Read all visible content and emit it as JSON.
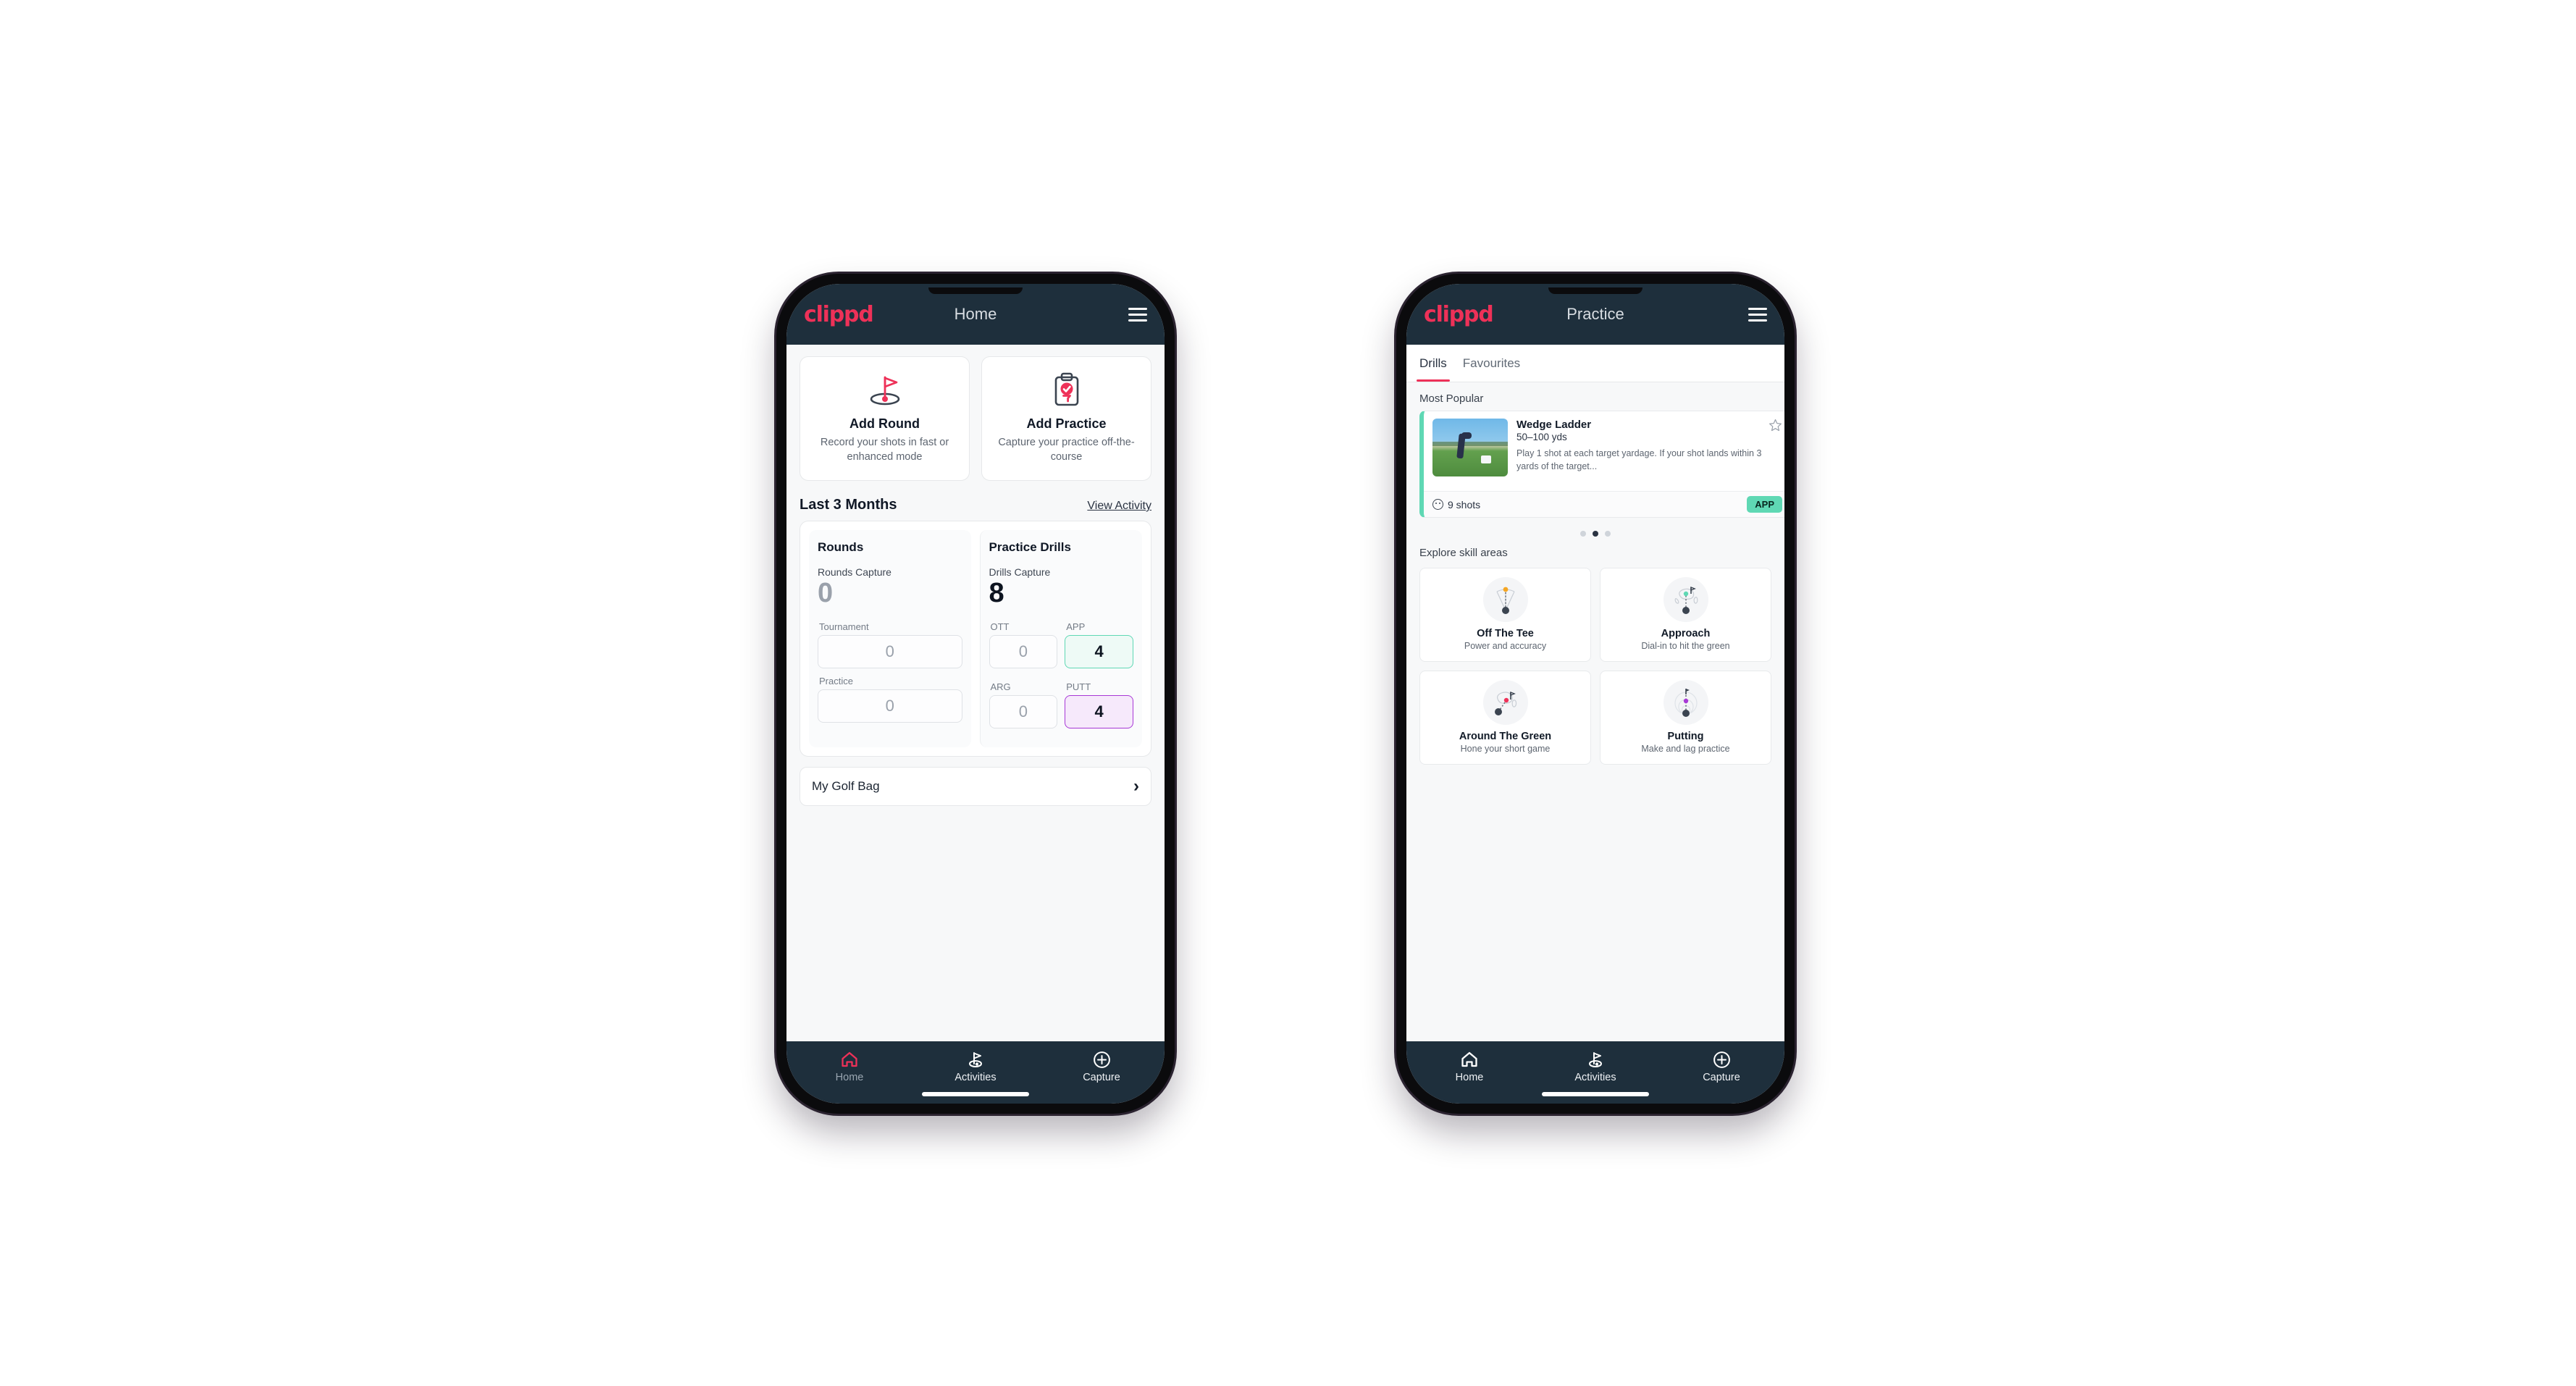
{
  "brand": {
    "logo_text": "clippd",
    "accent": "#ee3158",
    "appbar_bg": "#1e2f3c"
  },
  "phone_home": {
    "appbar": {
      "title": "Home",
      "menu_icon": "hamburger-menu-icon"
    },
    "actions": [
      {
        "icon": "golf-flag-hole-icon",
        "title": "Add Round",
        "subtitle": "Record your shots in fast or enhanced mode"
      },
      {
        "icon": "clipboard-check-icon",
        "title": "Add Practice",
        "subtitle": "Capture your practice off-the-course"
      }
    ],
    "section": {
      "title": "Last 3 Months",
      "link": "View Activity"
    },
    "rounds": {
      "heading": "Rounds",
      "capture_label": "Rounds Capture",
      "capture_value": "0",
      "fields": [
        {
          "label": "Tournament",
          "value": "0"
        },
        {
          "label": "Practice",
          "value": "0"
        }
      ]
    },
    "drills": {
      "heading": "Practice Drills",
      "capture_label": "Drills Capture",
      "capture_value": "8",
      "fields": [
        {
          "label": "OTT",
          "value": "0",
          "state": "plain"
        },
        {
          "label": "APP",
          "value": "4",
          "state": "app"
        },
        {
          "label": "ARG",
          "value": "0",
          "state": "plain"
        },
        {
          "label": "PUTT",
          "value": "4",
          "state": "putt"
        }
      ]
    },
    "bag_row": {
      "label": "My Golf Bag",
      "chevron": "›"
    },
    "bottom_nav": [
      {
        "icon": "home-icon",
        "label": "Home",
        "active": true
      },
      {
        "icon": "golf-flag-icon",
        "label": "Activities",
        "active": false
      },
      {
        "icon": "plus-circle-icon",
        "label": "Capture",
        "active": false
      }
    ]
  },
  "phone_practice": {
    "appbar": {
      "title": "Practice",
      "menu_icon": "hamburger-menu-icon"
    },
    "tabs": [
      {
        "label": "Drills",
        "active": true
      },
      {
        "label": "Favourites",
        "active": false
      }
    ],
    "most_popular_label": "Most Popular",
    "drill_card": {
      "title": "Wedge Ladder",
      "distance": "50–100 yds",
      "description": "Play 1 shot at each target yardage. If your shot lands within 3 yards of the target...",
      "shots": "9 shots",
      "badge": "APP",
      "badge_color": "#5fd8b4",
      "accent": "#5fd8b4",
      "star_icon": "star-outline-icon"
    },
    "carousel_dots": {
      "count": 3,
      "active_index": 1
    },
    "explore_label": "Explore skill areas",
    "skills": [
      {
        "icon": "off-the-tee-icon",
        "title": "Off The Tee",
        "subtitle": "Power and accuracy",
        "dot": "#f5a623"
      },
      {
        "icon": "approach-icon",
        "title": "Approach",
        "subtitle": "Dial-in to hit the green",
        "dot": "#5fd8b4"
      },
      {
        "icon": "around-the-green-icon",
        "title": "Around The Green",
        "subtitle": "Hone your short game",
        "dot": "#ee3158"
      },
      {
        "icon": "putting-icon",
        "title": "Putting",
        "subtitle": "Make and lag practice",
        "dot": "#a838d6"
      }
    ],
    "bottom_nav": [
      {
        "icon": "home-icon",
        "label": "Home",
        "active": false
      },
      {
        "icon": "golf-flag-icon",
        "label": "Activities",
        "active": true
      },
      {
        "icon": "plus-circle-icon",
        "label": "Capture",
        "active": false
      }
    ]
  }
}
